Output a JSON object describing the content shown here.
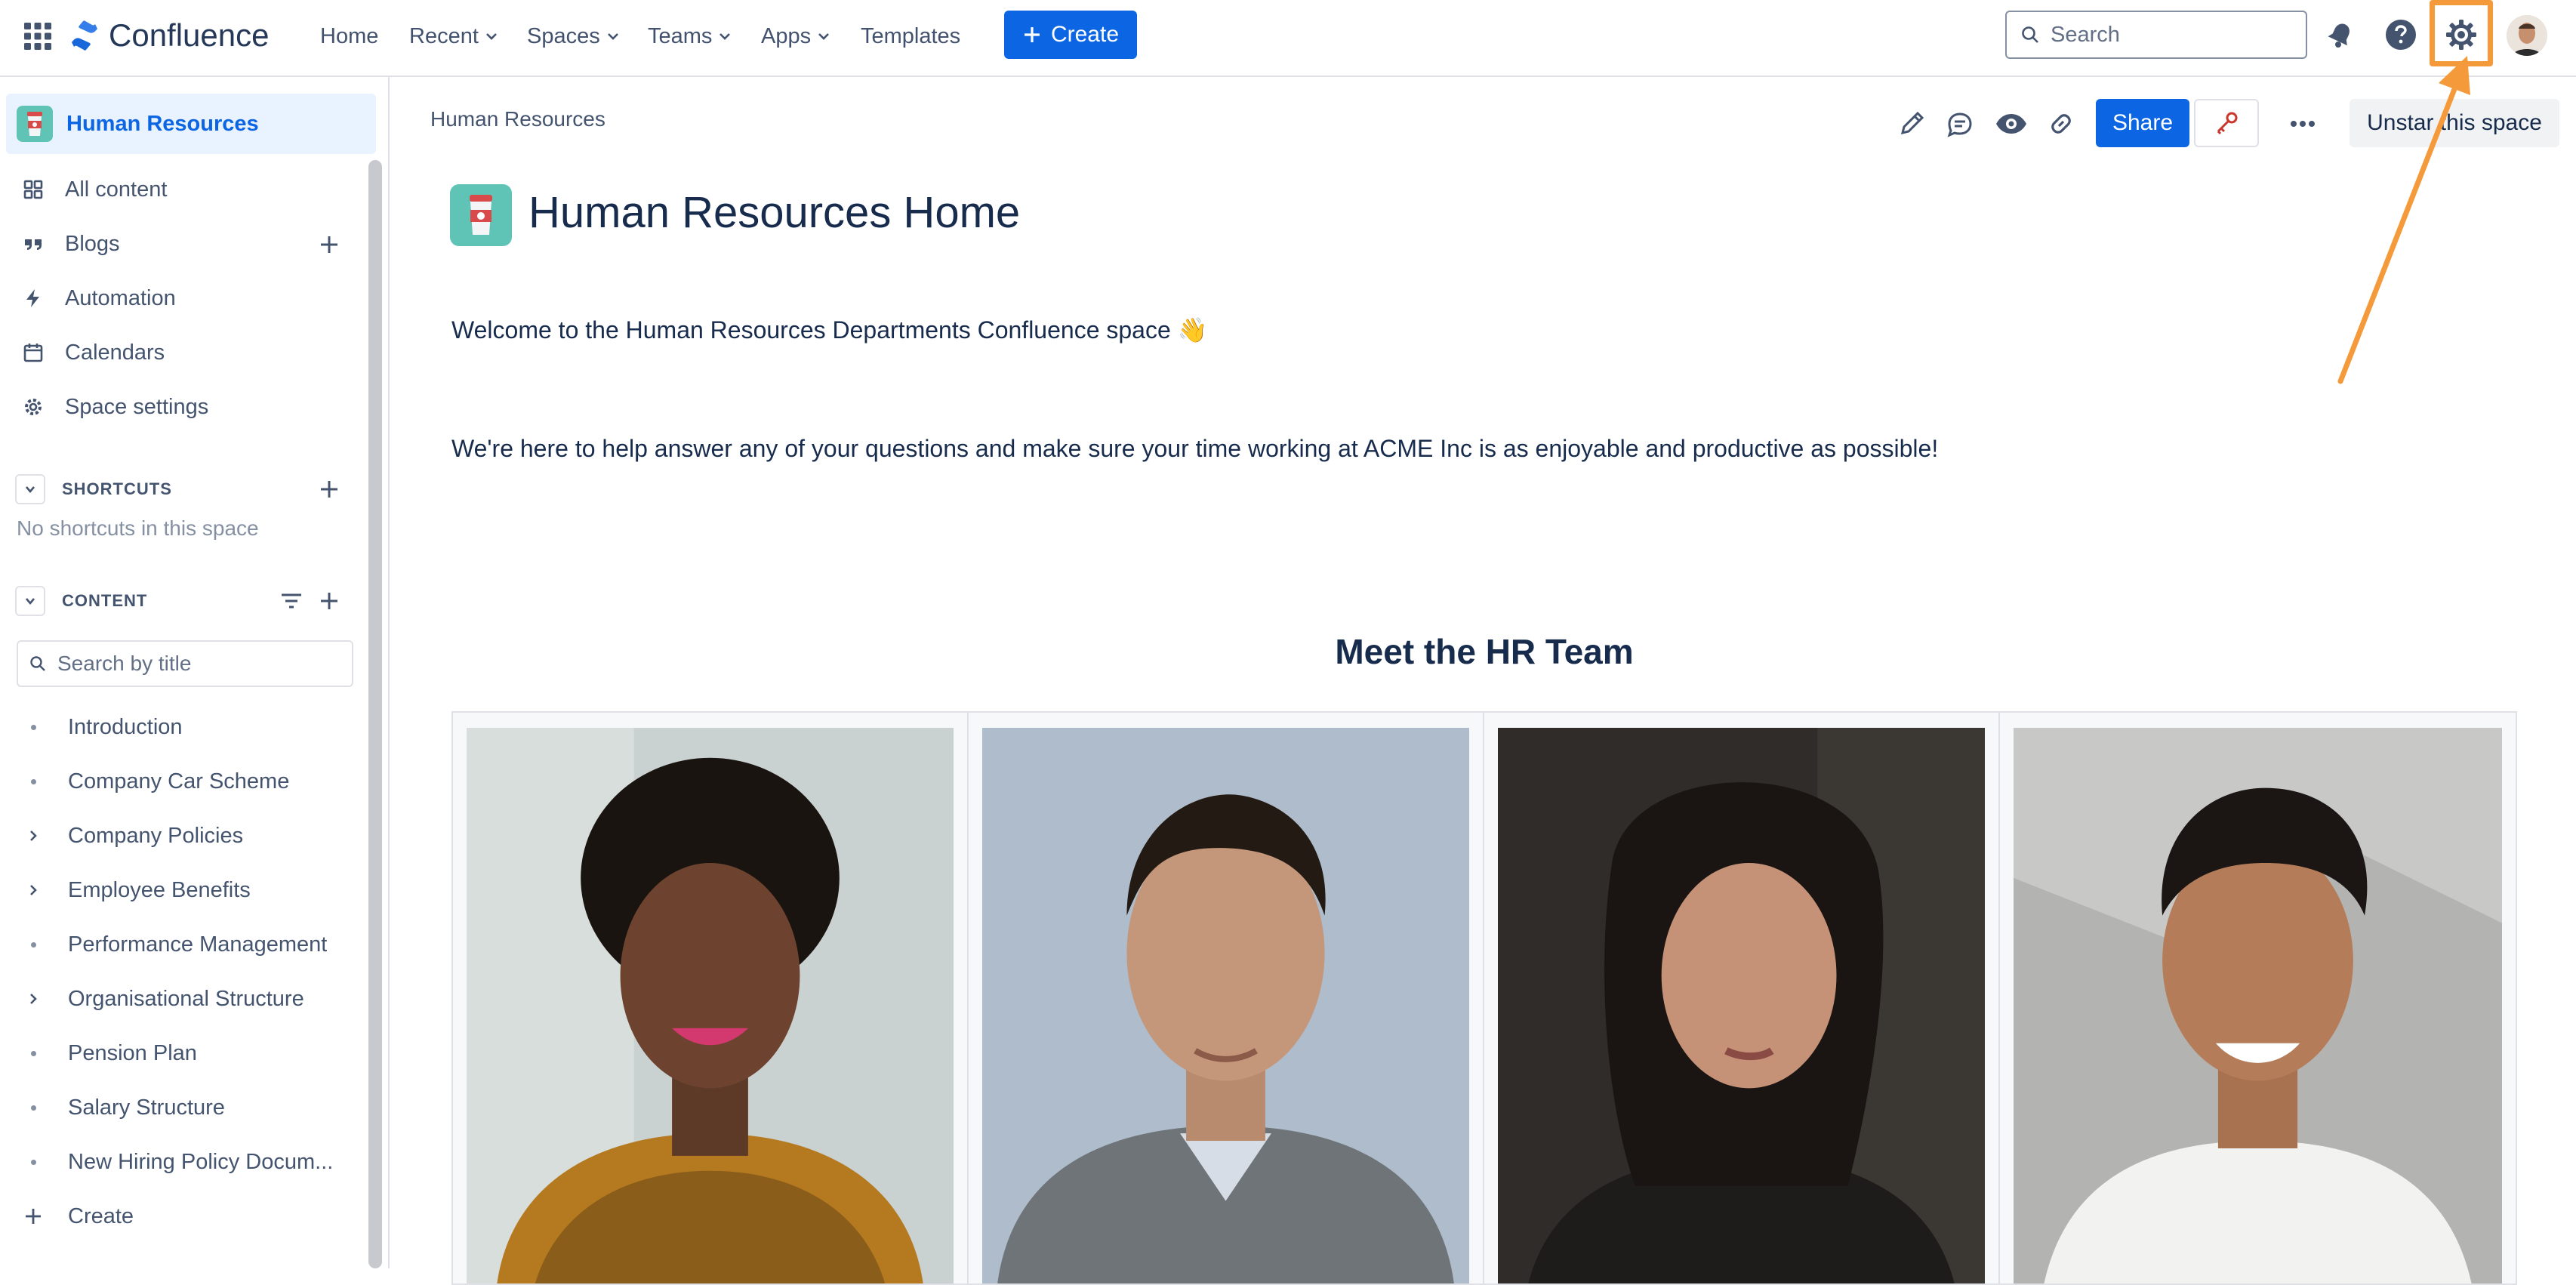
{
  "topnav": {
    "brand": "Confluence",
    "items": [
      {
        "label": "Home",
        "dropdown": false
      },
      {
        "label": "Recent",
        "dropdown": true
      },
      {
        "label": "Spaces",
        "dropdown": true
      },
      {
        "label": "Teams",
        "dropdown": true
      },
      {
        "label": "Apps",
        "dropdown": true
      },
      {
        "label": "Templates",
        "dropdown": false
      }
    ],
    "create_label": "Create",
    "search_placeholder": "Search",
    "accent": "#0c66e4"
  },
  "sidebar": {
    "space_name": "Human Resources",
    "items": [
      {
        "label": "All content",
        "icon": "grid-icon"
      },
      {
        "label": "Blogs",
        "icon": "quote-icon"
      },
      {
        "label": "Automation",
        "icon": "bolt-icon"
      },
      {
        "label": "Calendars",
        "icon": "calendar-icon"
      },
      {
        "label": "Space settings",
        "icon": "gear-icon"
      }
    ],
    "shortcuts": {
      "title": "SHORTCUTS",
      "empty": "No shortcuts in this space"
    },
    "content": {
      "title": "CONTENT",
      "search_placeholder": "Search by title",
      "tree": [
        {
          "label": "Introduction",
          "expandable": false
        },
        {
          "label": "Company Car Scheme",
          "expandable": false
        },
        {
          "label": "Company Policies",
          "expandable": true
        },
        {
          "label": "Employee Benefits",
          "expandable": true
        },
        {
          "label": "Performance Management",
          "expandable": false
        },
        {
          "label": "Organisational Structure",
          "expandable": true
        },
        {
          "label": "Pension Plan",
          "expandable": false
        },
        {
          "label": "Salary Structure",
          "expandable": false
        },
        {
          "label": "New Hiring Policy Docum...",
          "expandable": false
        }
      ],
      "create_label": "Create"
    }
  },
  "main": {
    "breadcrumb": "Human Resources",
    "share_label": "Share",
    "unstar_label": "Unstar this space",
    "page_title": "Human Resources Home",
    "welcome": "Welcome to the Human Resources Departments Confluence space 👋",
    "help_text": "We're here to help answer any of your questions and make sure your time working at ACME Inc is as enjoyable and productive as possible!",
    "team_heading": "Meet the HR Team"
  },
  "colors": {
    "highlight": "#f59a3a",
    "selected_bg": "#e9f2ff"
  }
}
